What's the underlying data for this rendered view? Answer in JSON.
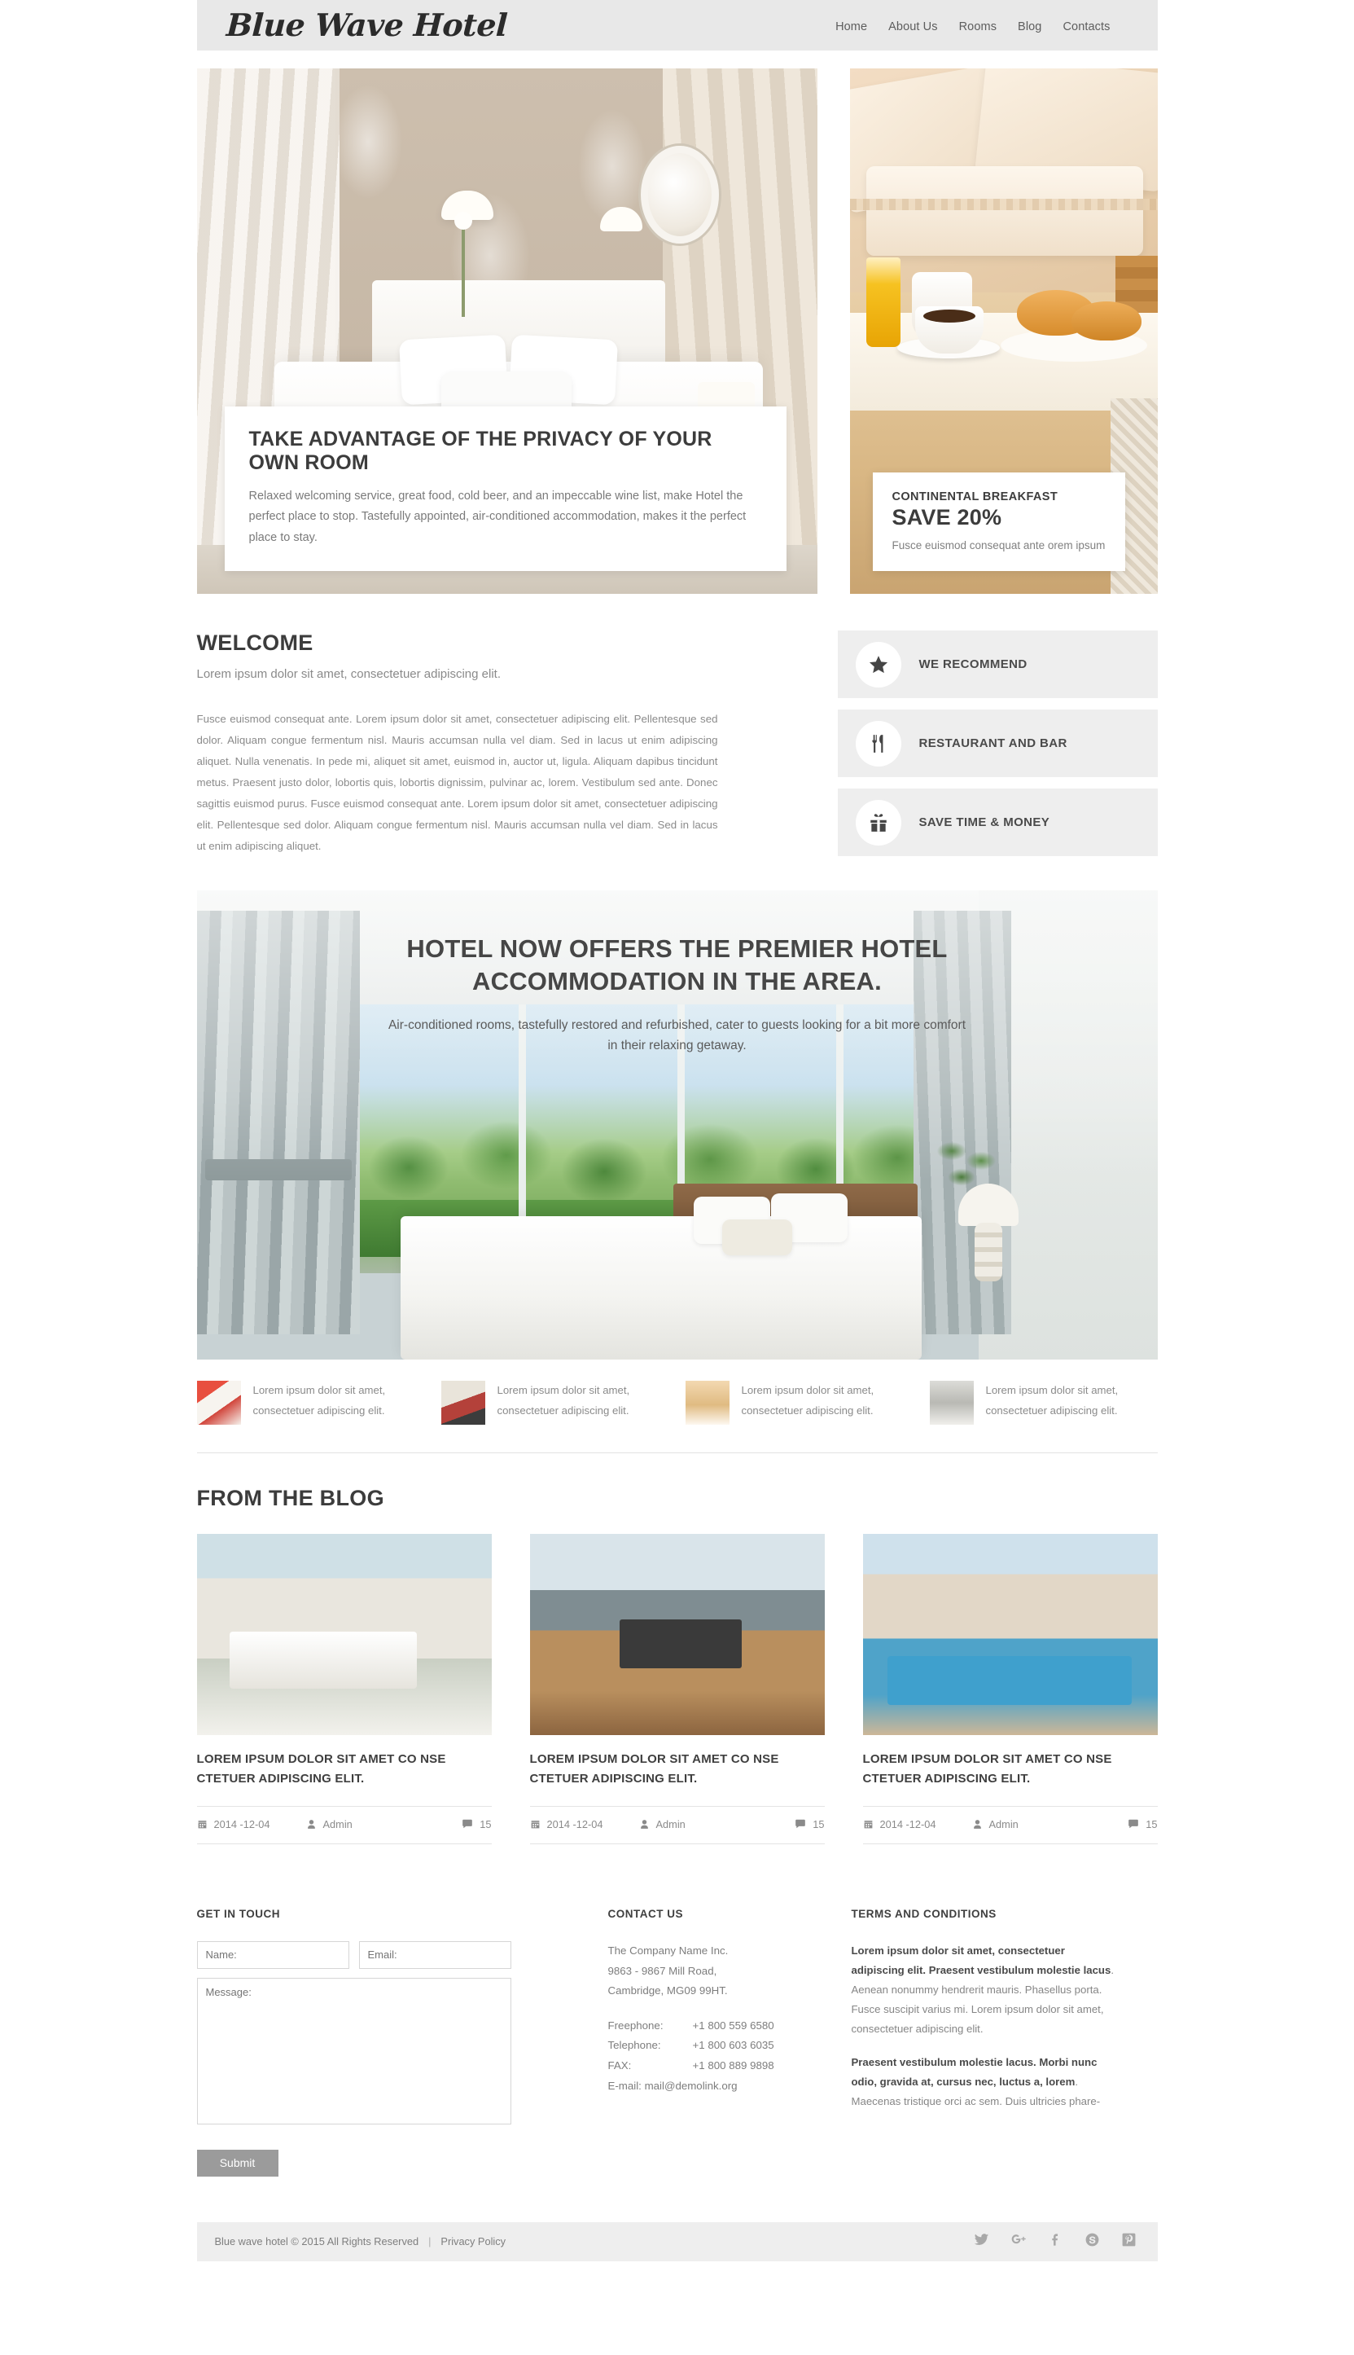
{
  "site": {
    "logo": "Blue Wave Hotel",
    "nav": [
      {
        "label": "Home"
      },
      {
        "label": "About Us"
      },
      {
        "label": "Rooms"
      },
      {
        "label": "Blog"
      },
      {
        "label": "Contacts"
      }
    ]
  },
  "hero": {
    "main": {
      "title": "TAKE ADVANTAGE OF THE PRIVACY OF YOUR OWN ROOM",
      "text": "Relaxed welcoming service, great food, cold beer, and an impeccable wine list, make Hotel the perfect place to stop. Tastefully appointed, air-conditioned accommodation, makes it the perfect place to stay."
    },
    "promo": {
      "kicker": "CONTINENTAL BREAKFAST",
      "headline": "SAVE 20%",
      "sub": "Fusce euismod consequat ante orem ipsum"
    }
  },
  "welcome": {
    "heading": "WELCOME",
    "lead": "Lorem ipsum dolor sit amet, consectetuer adipiscing elit.",
    "body": "Fusce euismod consequat ante. Lorem ipsum dolor sit amet, consectetuer adipiscing elit. Pellentesque sed dolor. Aliquam congue fermentum nisl. Mauris accumsan nulla vel diam. Sed in lacus ut enim adipiscing aliquet. Nulla venenatis. In pede mi, aliquet sit amet, euismod in, auctor ut, ligula. Aliquam dapibus tincidunt metus. Praesent justo dolor, lobortis quis, lobortis dignissim, pulvinar ac, lorem. Vestibulum sed ante. Donec sagittis euismod purus. Fusce euismod consequat ante. Lorem ipsum dolor sit amet, consectetuer adipiscing elit. Pellentesque sed dolor. Aliquam congue fermentum nisl. Mauris accumsan nulla vel diam. Sed in lacus ut enim adipiscing aliquet."
  },
  "features": [
    {
      "label": "WE RECOMMEND",
      "icon": "star-icon"
    },
    {
      "label": "RESTAURANT AND BAR",
      "icon": "cutlery-icon"
    },
    {
      "label": "SAVE TIME & MONEY",
      "icon": "gift-icon"
    }
  ],
  "banner": {
    "heading": "HOTEL NOW OFFERS THE PREMIER HOTEL ACCOMMODATION IN THE AREA.",
    "text": "Air-conditioned rooms, tastefully restored and refurbished, cater to guests looking for a bit more comfort in their relaxing getaway."
  },
  "thumbs": [
    {
      "text": "Lorem ipsum dolor sit amet, consectetuer adipiscing elit."
    },
    {
      "text": "Lorem ipsum dolor sit amet, consectetuer adipiscing elit."
    },
    {
      "text": "Lorem ipsum dolor sit amet, consectetuer adipiscing elit."
    },
    {
      "text": "Lorem ipsum dolor sit amet, consectetuer adipiscing elit."
    }
  ],
  "blog": {
    "heading": "FROM THE BLOG",
    "posts": [
      {
        "title": "LOREM IPSUM DOLOR SIT AMET CO NSE CTETUER ADIPISCING ELIT.",
        "date": "2014 -12-04",
        "author": "Admin",
        "comments": "15"
      },
      {
        "title": "LOREM IPSUM DOLOR SIT AMET CO NSE CTETUER ADIPISCING ELIT.",
        "date": "2014 -12-04",
        "author": "Admin",
        "comments": "15"
      },
      {
        "title": "LOREM IPSUM DOLOR SIT AMET CO NSE CTETUER ADIPISCING ELIT.",
        "date": "2014 -12-04",
        "author": "Admin",
        "comments": "15"
      }
    ]
  },
  "footer": {
    "form": {
      "heading": "GET IN TOUCH",
      "name_placeholder": "Name:",
      "email_placeholder": "Email:",
      "message_placeholder": "Message:",
      "submit_label": "Submit"
    },
    "contact": {
      "heading": "CONTACT US",
      "company": "The Company Name Inc.",
      "street": "9863 - 9867 Mill Road,",
      "city": "Cambridge, MG09 99HT.",
      "freephone_label": "Freephone:",
      "freephone_value": "+1 800 559 6580",
      "telephone_label": "Telephone:",
      "telephone_value": "+1 800 603 6035",
      "fax_label": "FAX:",
      "fax_value": "+1 800 889 9898",
      "email_line": "E-mail: mail@demolink.org"
    },
    "terms": {
      "heading": "TERMS AND CONDITIONS",
      "p1_bold": "Lorem ipsum dolor sit amet, consectetuer adipiscing elit. Praesent vestibulum molestie lacus",
      "p1_rest": ". Aenean nonummy hendrerit mauris. Phasellus porta. Fusce suscipit varius mi. Lorem ipsum dolor sit amet, consectetuer adipiscing elit.",
      "p2_bold": "Praesent vestibulum molestie lacus. Morbi nunc odio, gravida at, cursus nec, luctus a, lorem",
      "p2_rest": ". Maecenas tristique orci ac sem. Duis ultricies phare-"
    }
  },
  "bottom": {
    "copyright": "Blue wave hotel © 2015 All Rights Reserved",
    "separator": "|",
    "privacy": "Privacy Policy",
    "socials": [
      "twitter-icon",
      "google-plus-icon",
      "facebook-icon",
      "skype-icon",
      "pinterest-icon"
    ]
  }
}
